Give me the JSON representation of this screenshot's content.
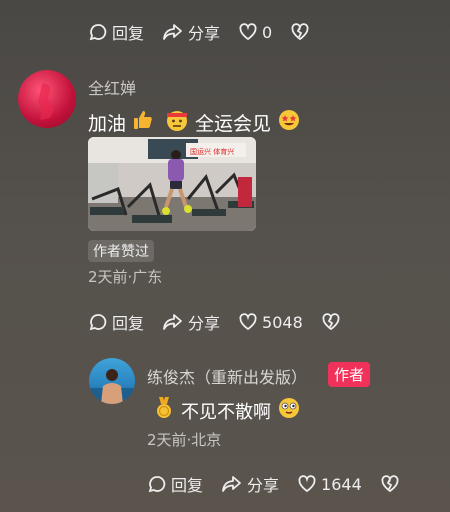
{
  "top_actions": {
    "reply": "回复",
    "share": "分享",
    "likes": "0"
  },
  "comment1": {
    "username": "全红婵",
    "text_a": "加油",
    "text_b": "全运会见",
    "badge": "作者赞过",
    "meta": "2天前·广东",
    "actions": {
      "reply": "回复",
      "share": "分享",
      "likes": "5048"
    },
    "image_banner": "国运兴 体育兴"
  },
  "comment2": {
    "username": "练俊杰（重新出发版）",
    "author_badge": "作者",
    "text": "不见不散啊",
    "meta": "2天前·北京",
    "actions": {
      "reply": "回复",
      "share": "分享",
      "likes": "1644"
    }
  },
  "colors": {
    "accent": "#f0315a",
    "bg": "#4f4c48"
  }
}
